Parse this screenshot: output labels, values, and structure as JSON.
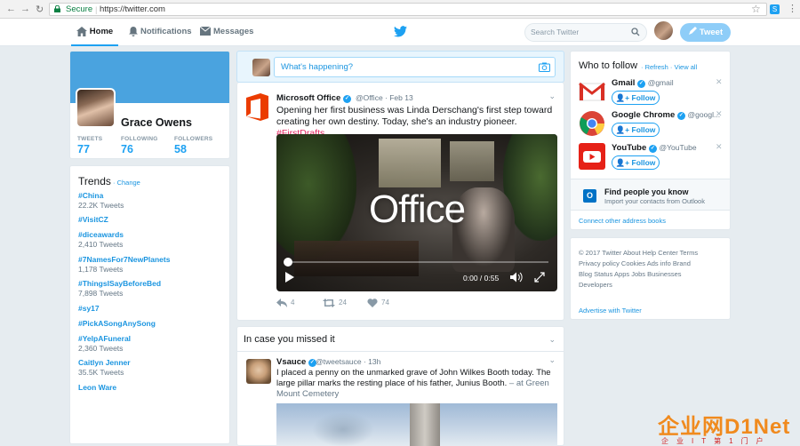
{
  "browser": {
    "secure_label": "Secure",
    "url": "https://twitter.com"
  },
  "nav": {
    "home": "Home",
    "notifications": "Notifications",
    "messages": "Messages",
    "search_placeholder": "Search Twitter",
    "tweet_button": "Tweet"
  },
  "profile": {
    "name": "Grace Owens",
    "stats": [
      {
        "label": "TWEETS",
        "value": "77"
      },
      {
        "label": "FOLLOWING",
        "value": "76"
      },
      {
        "label": "FOLLOWERS",
        "value": "58"
      }
    ]
  },
  "trends": {
    "title": "Trends",
    "change": "· Change",
    "items": [
      {
        "tag": "#China",
        "count": "22.2K Tweets"
      },
      {
        "tag": "#VisitCZ",
        "count": ""
      },
      {
        "tag": "#diceawards",
        "count": "2,410 Tweets"
      },
      {
        "tag": "#7NamesFor7NewPlanets",
        "count": "1,178 Tweets"
      },
      {
        "tag": "#ThingsISayBeforeBed",
        "count": "7,898 Tweets"
      },
      {
        "tag": "#sy17",
        "count": ""
      },
      {
        "tag": "#PickASongAnySong",
        "count": ""
      },
      {
        "tag": "#YelpAFuneral",
        "count": "2,360 Tweets"
      },
      {
        "tag": "Caitlyn Jenner",
        "count": "35.5K Tweets"
      },
      {
        "tag": "Leon Ware",
        "count": ""
      }
    ]
  },
  "compose": {
    "placeholder": "What's happening?"
  },
  "tweet": {
    "name": "Microsoft Office",
    "handle": "@Office · Feb 13",
    "text": "Opening her first business was Linda Derschang's first step toward creating her own destiny. Today, she's an industry pioneer. ",
    "hashtag": "#FirstDrafts",
    "video_title": "Office",
    "video_time": "0:00 / 0:55",
    "replies": "4",
    "retweets": "24",
    "likes": "74"
  },
  "icymi": {
    "title": "In case you missed it",
    "name": "Vsauce",
    "handle": "@tweetsauce · 13h",
    "text": "I placed a penny on the unmarked grave of John Wilkes Booth today. The large pillar marks the resting place of his father, Junius Booth. ",
    "location": "– at Green Mount Cemetery"
  },
  "who_to_follow": {
    "title": "Who to follow",
    "links": "· Refresh · View all",
    "accounts": [
      {
        "name": "Gmail",
        "handle": "@gmail"
      },
      {
        "name": "Google Chrome",
        "handle": "@googl..."
      },
      {
        "name": "YouTube",
        "handle": "@YouTube"
      }
    ],
    "follow_label": "Follow",
    "find_title": "Find people you know",
    "find_sub": "Import your contacts from Outlook",
    "connect": "Connect other address books"
  },
  "footer": {
    "lines": [
      "© 2017 Twitter  About  Help Center  Terms",
      "Privacy policy  Cookies  Ads info  Brand",
      "Blog  Status  Apps  Jobs  Businesses",
      "Developers"
    ],
    "advertise": "Advertise with Twitter"
  },
  "watermark": {
    "big": "企业网D1Net",
    "small": "企业IT第1门户"
  },
  "colors": {
    "accent": "#1da1f2",
    "banner": "#4aa3df",
    "hashtag": "#e0245e"
  }
}
